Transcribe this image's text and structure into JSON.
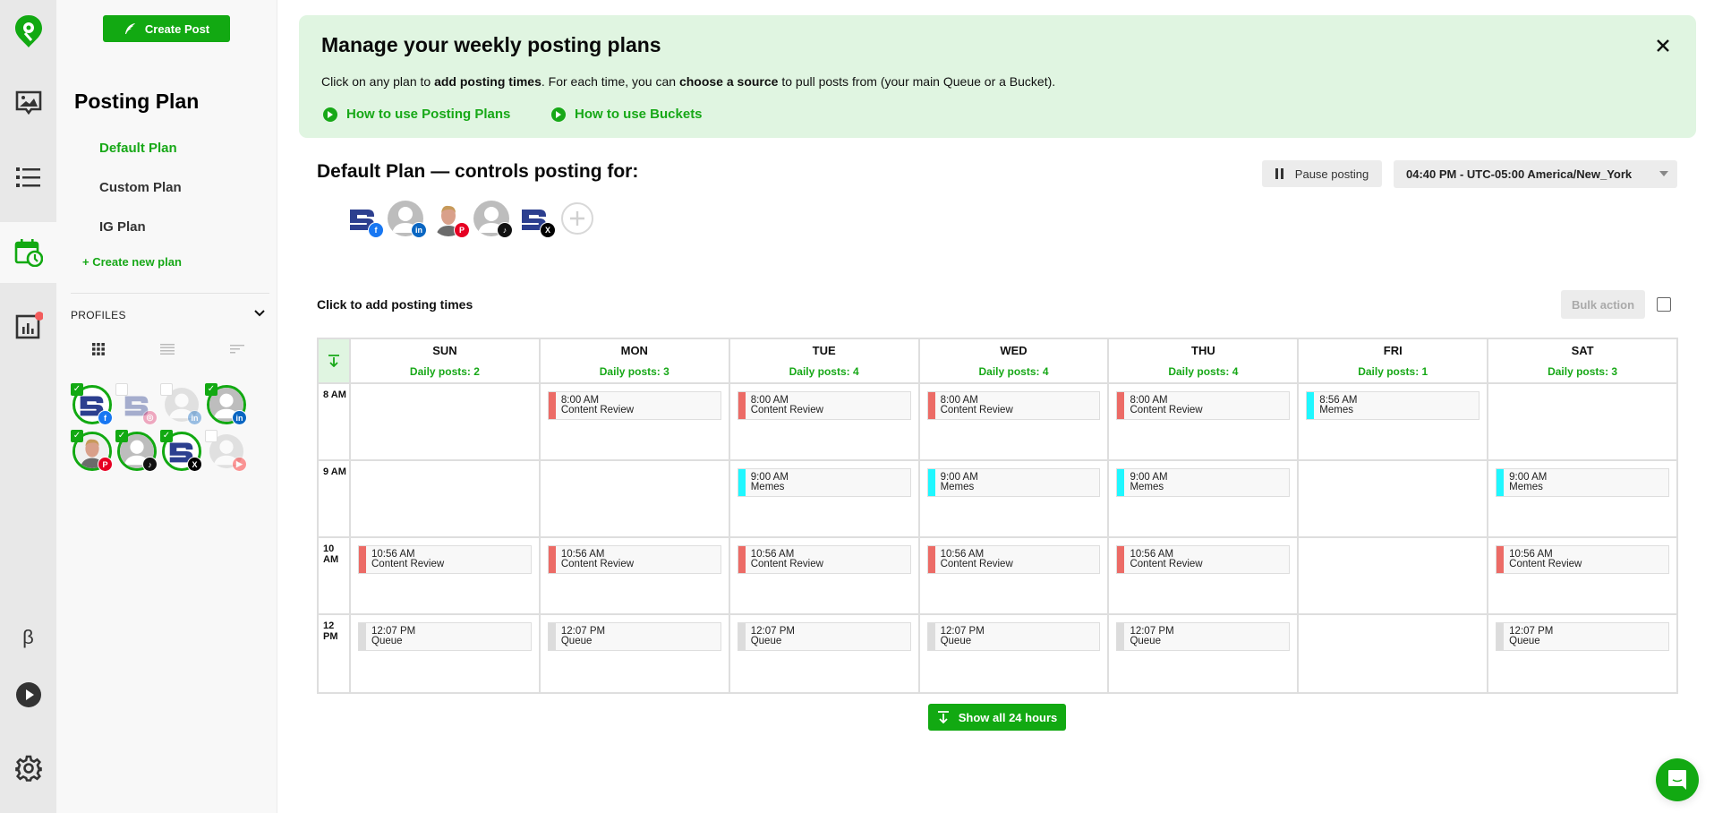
{
  "rail": {
    "items": [
      {
        "name": "logo",
        "icon": "location-pin-logo-icon"
      },
      {
        "name": "media",
        "icon": "image-chat-icon"
      },
      {
        "name": "list",
        "icon": "list-icon"
      },
      {
        "name": "posting-plan",
        "icon": "calendar-clock-icon",
        "active": true
      },
      {
        "name": "analytics",
        "icon": "bar-chart-icon",
        "badge": true
      },
      {
        "name": "beta",
        "icon": "beta-icon",
        "label": "β"
      },
      {
        "name": "tutorials",
        "icon": "play-circle-icon"
      },
      {
        "name": "settings",
        "icon": "gear-icon"
      }
    ],
    "accent": "#12a912",
    "badge_color": "#f25c5c"
  },
  "panel": {
    "create_post_label": "Create Post",
    "title": "Posting Plan",
    "plans": [
      {
        "label": "Default Plan",
        "active": true
      },
      {
        "label": "Custom Plan",
        "active": false
      },
      {
        "label": "IG Plan",
        "active": false
      }
    ],
    "create_plan_label": "+ Create new plan",
    "profiles_label": "PROFILES",
    "profiles": [
      {
        "avatar": "brand-logo",
        "network": "facebook",
        "selected": true
      },
      {
        "avatar": "brand-logo",
        "network": "instagram",
        "selected": false
      },
      {
        "avatar": "default-user",
        "network": "linkedin",
        "selected": false
      },
      {
        "avatar": "default-user",
        "network": "linkedin",
        "selected": true
      },
      {
        "avatar": "person-photo",
        "network": "pinterest",
        "selected": true
      },
      {
        "avatar": "default-user",
        "network": "tiktok",
        "selected": true
      },
      {
        "avatar": "brand-logo",
        "network": "x",
        "selected": true
      },
      {
        "avatar": "default-user",
        "network": "youtube",
        "selected": false
      }
    ]
  },
  "banner": {
    "title": "Manage your weekly posting plans",
    "text_1": "Click on any plan to ",
    "text_bold_1": "add posting times",
    "text_2": ". For each time, you can ",
    "text_bold_2": "choose a source",
    "text_3": " to pull posts from (your main Queue or a Bucket).",
    "link_1": "How to use Posting Plans",
    "link_2": "How to use Buckets"
  },
  "plan": {
    "heading": "Default Plan — controls posting for:",
    "pause_label": "Pause posting",
    "timezone": "04:40 PM - UTC-05:00 America/New_York",
    "avatars": [
      {
        "avatar": "brand-logo",
        "network": "facebook"
      },
      {
        "avatar": "default-user",
        "network": "linkedin"
      },
      {
        "avatar": "person-photo",
        "network": "pinterest"
      },
      {
        "avatar": "default-user",
        "network": "tiktok"
      },
      {
        "avatar": "brand-logo",
        "network": "x"
      }
    ],
    "click_to_add": "Click to add posting times",
    "bulk_action_label": "Bulk action",
    "show_all_label": "Show all 24 hours"
  },
  "sources": {
    "Content Review": "#ec6b66",
    "Memes": "#1ff7ff",
    "Queue": "#dcdcdc"
  },
  "schedule": {
    "hours": [
      "8 AM",
      "9 AM",
      "10 AM",
      "12 PM"
    ],
    "days": [
      {
        "name": "SUN",
        "count": "Daily posts: 2",
        "slots": [
          null,
          null,
          {
            "time": "10:56 AM",
            "source": "Content Review"
          },
          {
            "time": "12:07 PM",
            "source": "Queue"
          }
        ]
      },
      {
        "name": "MON",
        "count": "Daily posts: 3",
        "slots": [
          {
            "time": "8:00 AM",
            "source": "Content Review"
          },
          null,
          {
            "time": "10:56 AM",
            "source": "Content Review"
          },
          {
            "time": "12:07 PM",
            "source": "Queue"
          }
        ]
      },
      {
        "name": "TUE",
        "count": "Daily posts: 4",
        "slots": [
          {
            "time": "8:00 AM",
            "source": "Content Review"
          },
          {
            "time": "9:00 AM",
            "source": "Memes"
          },
          {
            "time": "10:56 AM",
            "source": "Content Review"
          },
          {
            "time": "12:07 PM",
            "source": "Queue"
          }
        ]
      },
      {
        "name": "WED",
        "count": "Daily posts: 4",
        "slots": [
          {
            "time": "8:00 AM",
            "source": "Content Review"
          },
          {
            "time": "9:00 AM",
            "source": "Memes"
          },
          {
            "time": "10:56 AM",
            "source": "Content Review"
          },
          {
            "time": "12:07 PM",
            "source": "Queue"
          }
        ]
      },
      {
        "name": "THU",
        "count": "Daily posts: 4",
        "slots": [
          {
            "time": "8:00 AM",
            "source": "Content Review"
          },
          {
            "time": "9:00 AM",
            "source": "Memes"
          },
          {
            "time": "10:56 AM",
            "source": "Content Review"
          },
          {
            "time": "12:07 PM",
            "source": "Queue"
          }
        ]
      },
      {
        "name": "FRI",
        "count": "Daily posts: 1",
        "slots": [
          {
            "time": "8:56 AM",
            "source": "Memes"
          },
          null,
          null,
          null
        ]
      },
      {
        "name": "SAT",
        "count": "Daily posts: 3",
        "slots": [
          null,
          {
            "time": "9:00 AM",
            "source": "Memes"
          },
          {
            "time": "10:56 AM",
            "source": "Content Review"
          },
          {
            "time": "12:07 PM",
            "source": "Queue"
          }
        ]
      }
    ]
  },
  "network_colors": {
    "facebook": "#1877f2",
    "instagram": "#e1306c",
    "linkedin": "#0a66c2",
    "pinterest": "#e60023",
    "tiktok": "#111111",
    "x": "#000000",
    "youtube": "#ff0000"
  }
}
